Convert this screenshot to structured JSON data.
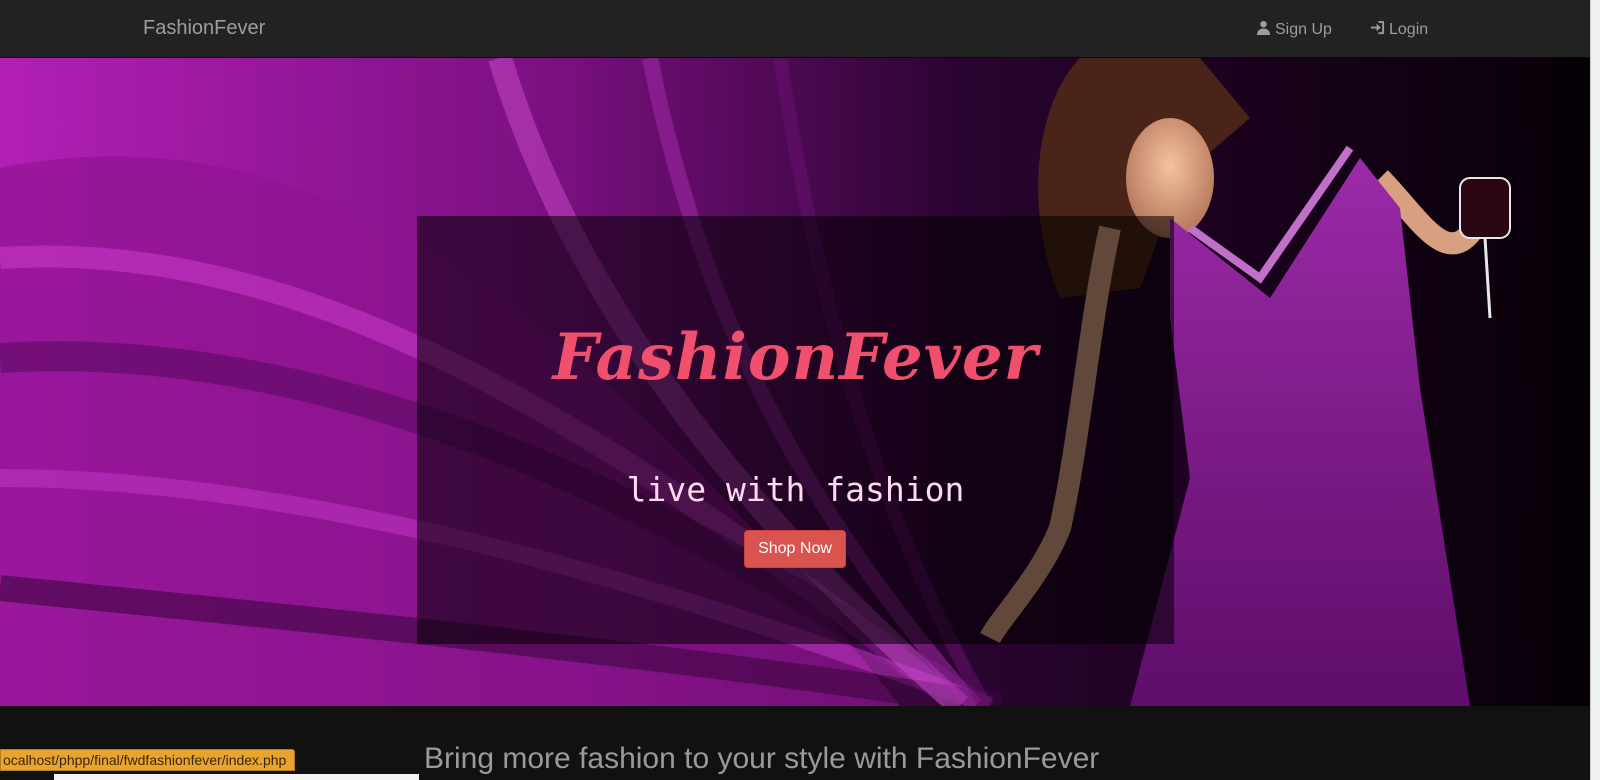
{
  "navbar": {
    "brand": "FashionFever",
    "signup_label": "Sign Up",
    "login_label": "Login",
    "signup_icon": "user-icon",
    "login_icon": "login-icon"
  },
  "hero": {
    "title": "FashionFever",
    "tagline": "live with fashion",
    "cta_label": "Shop Now",
    "title_color": "#f0506e",
    "cta_color": "#d9534f"
  },
  "section": {
    "heading": "Bring more fashion to your style with FashionFever"
  },
  "status_bar": {
    "url": "ocalhost/phpp/final/fwdfashionfever/index.php"
  }
}
